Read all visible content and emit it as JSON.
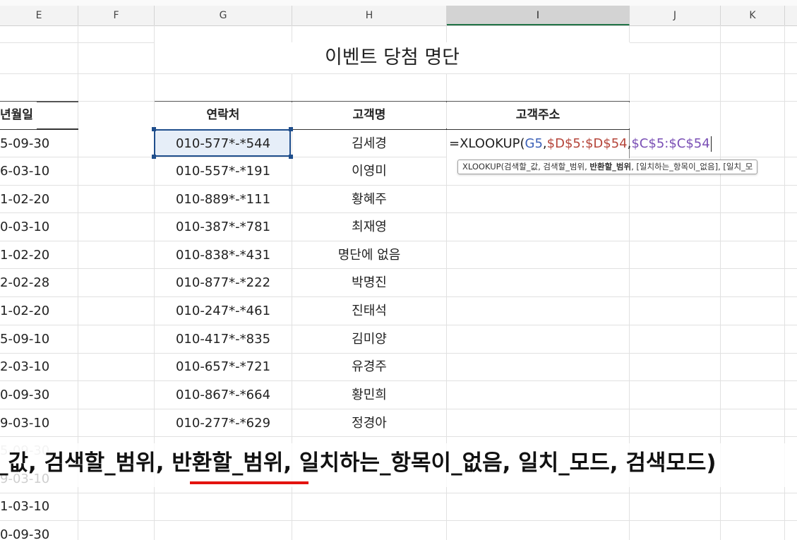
{
  "columns": [
    {
      "letter": "E",
      "active": false
    },
    {
      "letter": "F",
      "active": false
    },
    {
      "letter": "G",
      "active": false
    },
    {
      "letter": "H",
      "active": false
    },
    {
      "letter": "I",
      "active": true
    },
    {
      "letter": "J",
      "active": false
    },
    {
      "letter": "K",
      "active": false
    }
  ],
  "sheet": {
    "title": "이벤트 당첨 명단",
    "headers": {
      "birth": "년월일",
      "contact": "연락처",
      "name": "고객명",
      "address": "고객주소"
    },
    "rows": [
      {
        "date": "5-09-30",
        "contact": "010-577*-*544",
        "name": "김세경"
      },
      {
        "date": "6-03-10",
        "contact": "010-557*-*191",
        "name": "이영미"
      },
      {
        "date": "1-02-20",
        "contact": "010-889*-*111",
        "name": "황혜주"
      },
      {
        "date": "0-03-10",
        "contact": "010-387*-*781",
        "name": "최재영"
      },
      {
        "date": "1-02-20",
        "contact": "010-838*-*431",
        "name": "명단에 없음"
      },
      {
        "date": "2-02-28",
        "contact": "010-877*-*222",
        "name": "박명진"
      },
      {
        "date": "1-02-20",
        "contact": "010-247*-*461",
        "name": "진태석"
      },
      {
        "date": "5-09-10",
        "contact": "010-417*-*835",
        "name": "김미양"
      },
      {
        "date": "2-03-10",
        "contact": "010-657*-*721",
        "name": "유경주"
      },
      {
        "date": "0-09-30",
        "contact": "010-867*-*664",
        "name": "황민희"
      },
      {
        "date": "9-03-10",
        "contact": "010-277*-*629",
        "name": "정경아"
      }
    ],
    "extra_dates": [
      "5-09-30",
      "9-03-10",
      "1-03-10",
      "0-09-30"
    ]
  },
  "formula": {
    "prefix": "=XLOOKUP(",
    "arg1": "G5",
    "sep1": ",",
    "arg2": "$D$5:$D$54",
    "sep2": ",",
    "arg3": "$C$5:$C$54"
  },
  "tooltip": {
    "prefix": "XLOOKUP(검색할_값, 검색할_범위, ",
    "bold": "반환할_범위",
    "suffix": ", [일치하는_항목이_없음], [일치_모"
  },
  "caption": {
    "text": "_값, 검색할_범위, 반환할_범위, 일치하는_항목이_없음, 일치_모드, 검색모드)"
  },
  "colors": {
    "selection_border": "#1f4e8c",
    "selection_fill": "#e6eef8",
    "active_column_accent": "#217346",
    "underline_accent": "#e3130f",
    "formula_ref1": "#3d62b8",
    "formula_ref2": "#b5453a",
    "formula_ref3": "#7a4fb5"
  }
}
